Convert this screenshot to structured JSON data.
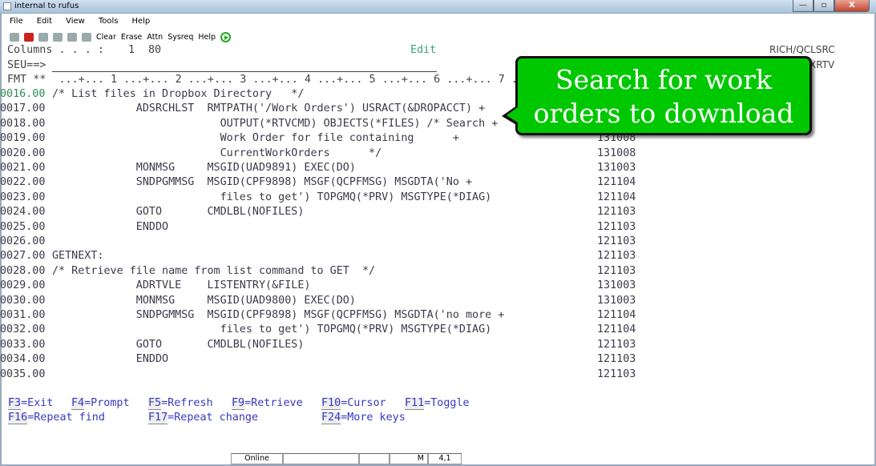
{
  "window": {
    "title": "internal to rufus",
    "min": "—",
    "max": "▫",
    "close": "X"
  },
  "menu": [
    "File",
    "Edit",
    "View",
    "Tools",
    "Help"
  ],
  "toolbar": {
    "icons": [
      "print-screen-icon",
      "disconnect-icon",
      "copy-icon",
      "paste-icon",
      "printer-icon",
      "macro-icon"
    ],
    "buttons": [
      "Clear",
      "Erase",
      "Attn",
      "Sysreq",
      "Help"
    ],
    "run_icon": "play-icon"
  },
  "screen": {
    "columns_label": "Columns . . . :",
    "col_from": "1",
    "col_to": "80",
    "mode": "Edit",
    "source": "RICH/QCLSRC",
    "member": "XRTV",
    "seu_prompt": "SEU==>",
    "fmt": "FMT **  ...+... 1 ...+... 2 ...+... 3 ...+... 4 ...+... 5 ...+... 6 ...+... 7 .",
    "lines": [
      {
        "seq": "0016.00",
        "text": "/* List files in Dropbox Directory   */",
        "date": ""
      },
      {
        "seq": "0017.00",
        "text": "             ADSRCHLST  RMTPATH('/Work Orders') USRACT(&DROPACCT) +",
        "date": ""
      },
      {
        "seq": "0018.00",
        "text": "                          OUTPUT(*RTVCMD) OBJECTS(*FILES) /* Search +",
        "date": ""
      },
      {
        "seq": "0019.00",
        "text": "                          Work Order for file containing      +",
        "date": "131008"
      },
      {
        "seq": "0020.00",
        "text": "                          CurrentWorkOrders      */",
        "date": "131008"
      },
      {
        "seq": "0021.00",
        "text": "             MONMSG     MSGID(UAD9891) EXEC(DO)",
        "date": "131003"
      },
      {
        "seq": "0022.00",
        "text": "             SNDPGMMSG  MSGID(CPF9898) MSGF(QCPFMSG) MSGDTA('No +",
        "date": "121104"
      },
      {
        "seq": "0023.00",
        "text": "                          files to get') TOPGMQ(*PRV) MSGTYPE(*DIAG)",
        "date": "121104"
      },
      {
        "seq": "0024.00",
        "text": "             GOTO       CMDLBL(NOFILES)",
        "date": "121103"
      },
      {
        "seq": "0025.00",
        "text": "             ENDDO",
        "date": "121103"
      },
      {
        "seq": "0026.00",
        "text": "",
        "date": "121103"
      },
      {
        "seq": "0027.00",
        "text": "GETNEXT:",
        "date": "121103"
      },
      {
        "seq": "0028.00",
        "text": "/* Retrieve file name from list command to GET  */",
        "date": "121103"
      },
      {
        "seq": "0029.00",
        "text": "             ADRTVLE    LISTENTRY(&FILE)",
        "date": "131003"
      },
      {
        "seq": "0030.00",
        "text": "             MONMSG     MSGID(UAD9800) EXEC(DO)",
        "date": "131003"
      },
      {
        "seq": "0031.00",
        "text": "             SNDPGMMSG  MSGID(CPF9898) MSGF(QCPFMSG) MSGDTA('no more +",
        "date": "121104"
      },
      {
        "seq": "0032.00",
        "text": "                          files to get') TOPGMQ(*PRV) MSGTYPE(*DIAG)",
        "date": "121104"
      },
      {
        "seq": "0033.00",
        "text": "             GOTO       CMDLBL(NOFILES)",
        "date": "121103"
      },
      {
        "seq": "0034.00",
        "text": "             ENDDO",
        "date": "121103"
      },
      {
        "seq": "0035.00",
        "text": "",
        "date": "121103"
      }
    ],
    "fkeys_row1": [
      {
        "key": "F3",
        "label": "=Exit"
      },
      {
        "key": "F4",
        "label": "=Prompt"
      },
      {
        "key": "F5",
        "label": "=Refresh"
      },
      {
        "key": "F9",
        "label": "=Retrieve"
      },
      {
        "key": "F10",
        "label": "=Cursor"
      },
      {
        "key": "F11",
        "label": "=Toggle"
      }
    ],
    "fkeys_row2": [
      {
        "key": "F16",
        "label": "=Repeat find"
      },
      {
        "key": "F17",
        "label": "=Repeat change"
      },
      {
        "key": "F24",
        "label": "=More keys"
      }
    ]
  },
  "callout": {
    "line1": "Search for work",
    "line2": "orders to download",
    "color": "#00c800"
  },
  "status": {
    "state": "Online",
    "mode": "M",
    "cursor": "4,1"
  }
}
